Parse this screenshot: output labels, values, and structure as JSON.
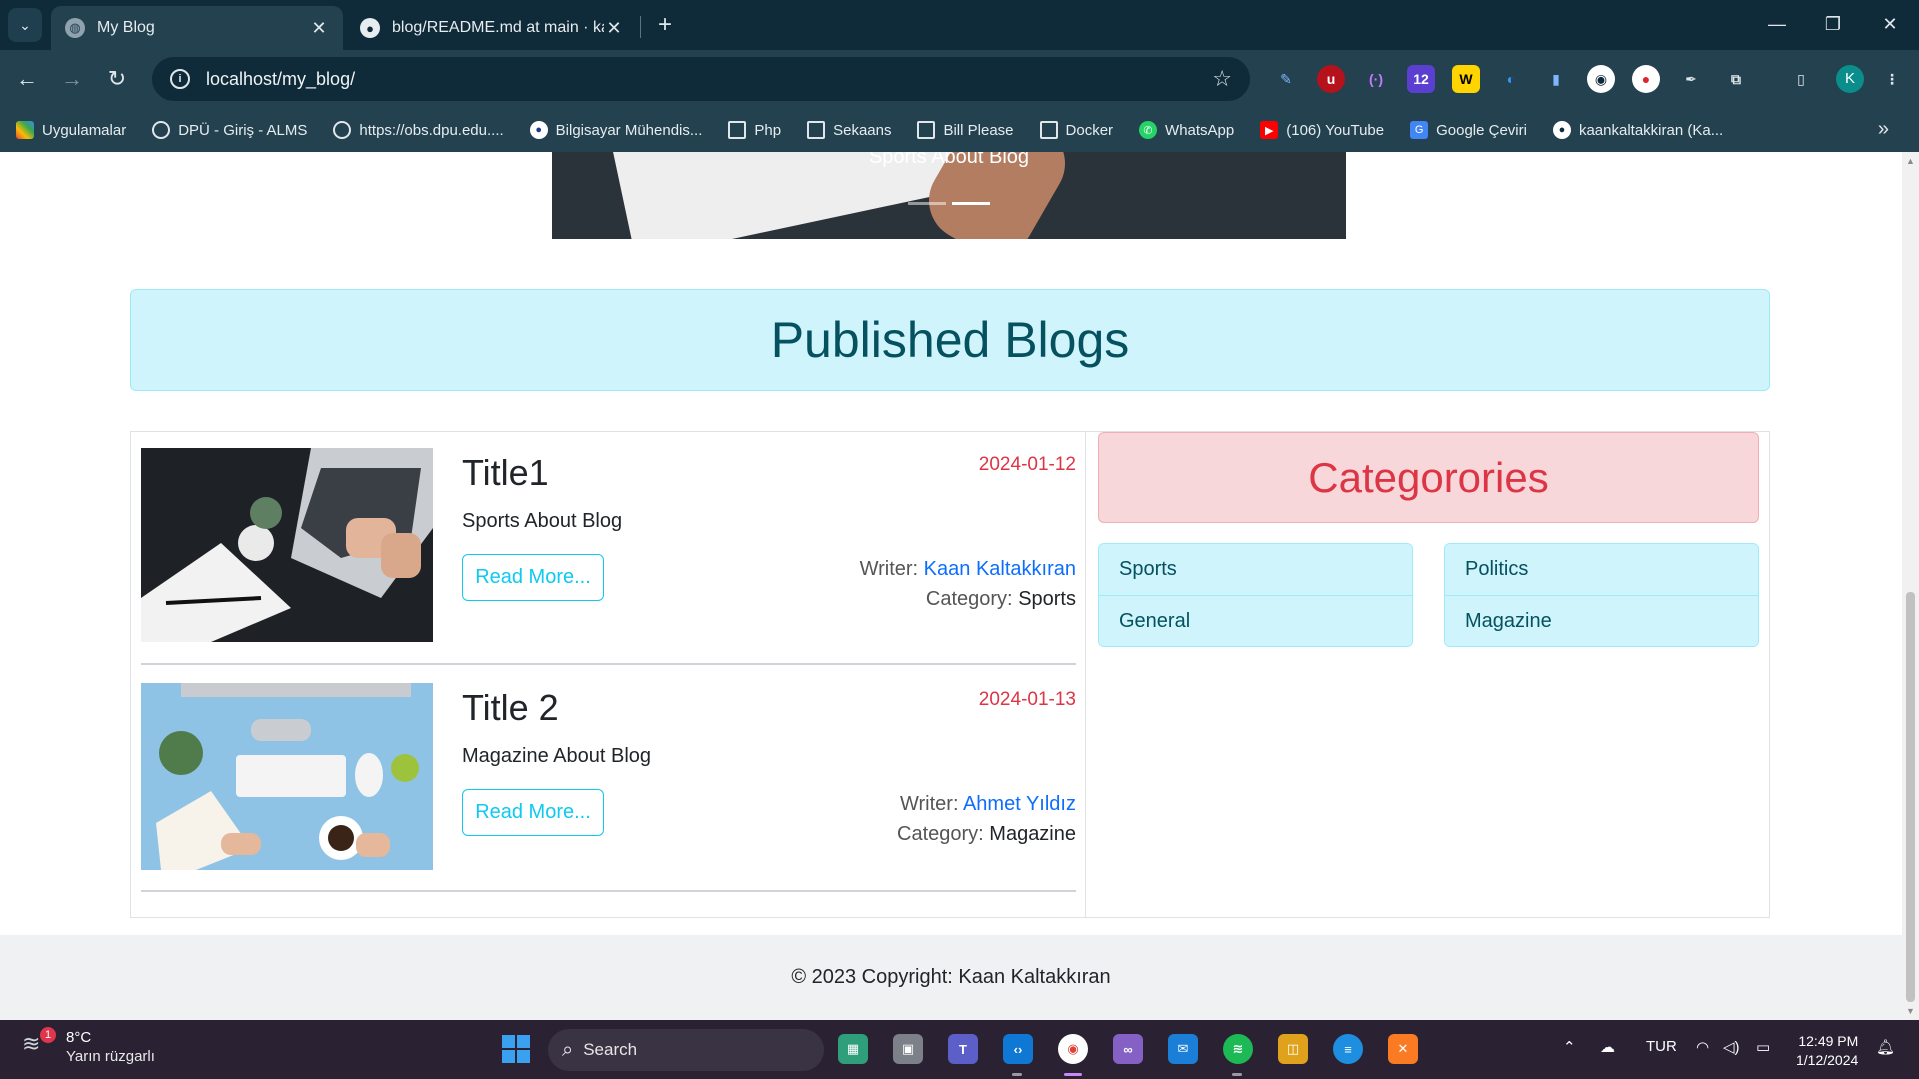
{
  "browser": {
    "tabs": [
      {
        "title": "My Blog",
        "active": true
      },
      {
        "title": "blog/README.md at main · kaa",
        "active": false
      }
    ],
    "url": "localhost/my_blog/",
    "bookmarks": [
      {
        "label": "Uygulamalar",
        "icon": "apps-grid-icon"
      },
      {
        "label": "DPÜ - Giriş - ALMS",
        "icon": "globe-icon"
      },
      {
        "label": "https://obs.dpu.edu....",
        "icon": "globe-icon"
      },
      {
        "label": "Bilgisayar Mühendis...",
        "icon": "site-icon"
      },
      {
        "label": "Php",
        "icon": "folder-icon"
      },
      {
        "label": "Sekaans",
        "icon": "folder-icon"
      },
      {
        "label": "Bill Please",
        "icon": "folder-icon"
      },
      {
        "label": "Docker",
        "icon": "folder-icon"
      },
      {
        "label": "WhatsApp",
        "icon": "whatsapp-icon"
      },
      {
        "label": "(106) YouTube",
        "icon": "youtube-icon"
      },
      {
        "label": "Google Çeviri",
        "icon": "translate-icon"
      },
      {
        "label": "kaankaltakkiran (Ka...",
        "icon": "github-icon"
      }
    ],
    "profile_initial": "K"
  },
  "page": {
    "carousel": {
      "caption": "Sports About Blog"
    },
    "section_title": "Published Blogs",
    "posts": [
      {
        "title": "Title1",
        "description": "Sports About Blog",
        "date": "2024-01-12",
        "read_more": "Read More...",
        "writer_label": "Writer:",
        "writer": "Kaan Kaltakkıran",
        "category_label": "Category:",
        "category": "Sports"
      },
      {
        "title": "Title 2",
        "description": "Magazine About Blog",
        "date": "2024-01-13",
        "read_more": "Read More...",
        "writer_label": "Writer:",
        "writer": "Ahmet Yıldız",
        "category_label": "Category:",
        "category": "Magazine"
      }
    ],
    "categories": {
      "title": "Categorories",
      "left": [
        "Sports",
        "General"
      ],
      "right": [
        "Politics",
        "Magazine"
      ]
    },
    "footer": "© 2023 Copyright: Kaan Kaltakkıran"
  },
  "taskbar": {
    "weather_temp": "8°C",
    "weather_desc": "Yarın rüzgarlı",
    "weather_badge": "1",
    "search_label": "Search",
    "language": "TUR",
    "time": "12:49 PM",
    "date": "1/12/2024"
  },
  "colors": {
    "chrome_dark": "#0f2a38",
    "chrome_mid": "#24414f",
    "info_bg": "#cff4fc",
    "info_text": "#055160",
    "danger": "#dc3545",
    "danger_bg": "#f8d7da",
    "link": "#0d6efd",
    "outline_info": "#0dcaf0"
  }
}
